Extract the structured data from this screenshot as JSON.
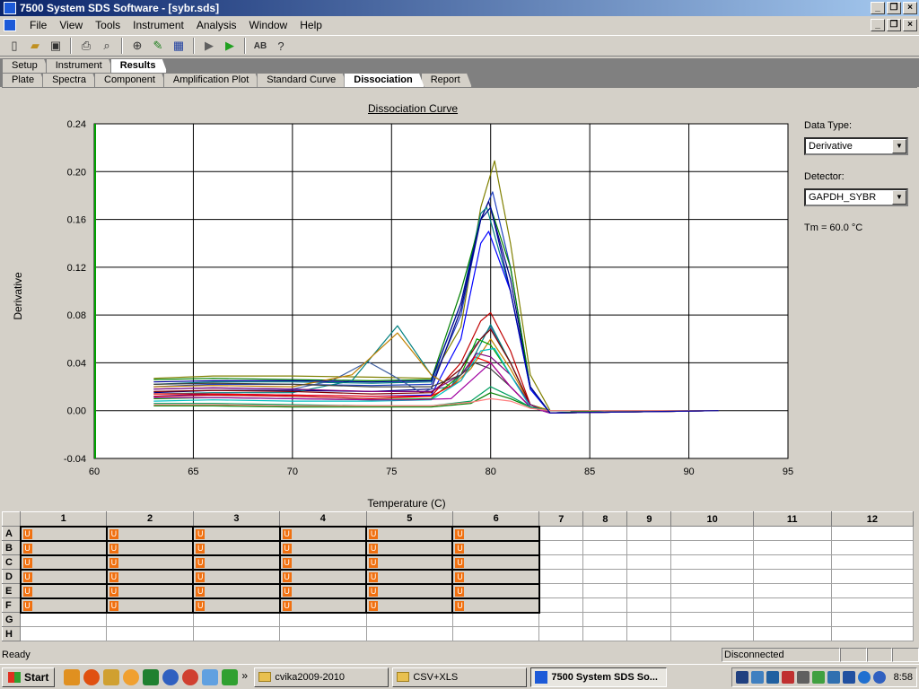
{
  "window": {
    "title": "7500 System SDS Software - [sybr.sds]"
  },
  "menu": [
    "File",
    "View",
    "Tools",
    "Instrument",
    "Analysis",
    "Window",
    "Help"
  ],
  "tabs_top": [
    "Setup",
    "Instrument",
    "Results"
  ],
  "tabs_top_active": "Results",
  "tabs_sub": [
    "Plate",
    "Spectra",
    "Component",
    "Amplification Plot",
    "Standard Curve",
    "Dissociation",
    "Report"
  ],
  "tabs_sub_active": "Dissociation",
  "side": {
    "data_type_label": "Data Type:",
    "data_type_value": "Derivative",
    "detector_label": "Detector:",
    "detector_value": "GAPDH_SYBR",
    "tm_text": "Tm = 60.0 °C"
  },
  "chart_data": {
    "type": "line",
    "title": "Dissociation Curve",
    "xlabel": "Temperature (C)",
    "ylabel": "Derivative",
    "xlim": [
      60,
      95
    ],
    "ylim": [
      -0.04,
      0.24
    ],
    "xticks": [
      60,
      65,
      70,
      75,
      80,
      85,
      90,
      95
    ],
    "yticks": [
      "0.24",
      "0.20",
      "0.16",
      "0.12",
      "0.08",
      "0.04",
      "0.00",
      "-0.04"
    ],
    "grid": true,
    "series": [
      {
        "color": "#808000",
        "x": [
          63,
          66,
          70,
          74,
          77,
          78.5,
          79.5,
          80.2,
          81,
          82,
          83,
          86,
          91.5
        ],
        "y": [
          0.027,
          0.029,
          0.029,
          0.028,
          0.027,
          0.07,
          0.17,
          0.209,
          0.14,
          0.03,
          0.0,
          0.0,
          0.0
        ]
      },
      {
        "color": "#2040c0",
        "x": [
          63,
          66,
          70,
          74,
          77,
          78.5,
          79.5,
          80.1,
          81,
          82,
          83,
          86,
          91.5
        ],
        "y": [
          0.02,
          0.022,
          0.022,
          0.021,
          0.022,
          0.08,
          0.16,
          0.183,
          0.12,
          0.02,
          -0.002,
          0.0,
          0.0
        ]
      },
      {
        "color": "#000080",
        "x": [
          63,
          66,
          70,
          74,
          77,
          78.5,
          79.5,
          79.9,
          81,
          82,
          83,
          86,
          91.5
        ],
        "y": [
          0.015,
          0.017,
          0.017,
          0.016,
          0.018,
          0.085,
          0.16,
          0.175,
          0.11,
          0.02,
          -0.002,
          0.0,
          0.0
        ]
      },
      {
        "color": "#008080",
        "x": [
          63,
          66,
          70,
          74,
          77,
          78.5,
          79.5,
          79.8,
          81,
          82,
          83,
          86,
          91.5
        ],
        "y": [
          0.022,
          0.024,
          0.024,
          0.023,
          0.024,
          0.09,
          0.165,
          0.17,
          0.1,
          0.018,
          -0.002,
          0.0,
          0.0
        ]
      },
      {
        "color": "#0000ff",
        "x": [
          63,
          66,
          70,
          74,
          77,
          78.5,
          79.5,
          79.9,
          81,
          82,
          83,
          86,
          91.5
        ],
        "y": [
          0.012,
          0.014,
          0.013,
          0.012,
          0.013,
          0.06,
          0.14,
          0.15,
          0.1,
          0.018,
          -0.002,
          0.0,
          0.0
        ]
      },
      {
        "color": "#008000",
        "x": [
          63,
          66,
          70,
          74,
          77,
          78.5,
          79.5,
          80.0,
          81,
          82,
          83,
          86,
          91.5
        ],
        "y": [
          0.026,
          0.027,
          0.026,
          0.025,
          0.026,
          0.1,
          0.16,
          0.17,
          0.12,
          0.02,
          -0.002,
          0.0,
          0.0
        ]
      },
      {
        "color": "#4060a0",
        "x": [
          63,
          66,
          70,
          72,
          73.8,
          75,
          76.5,
          77,
          78,
          79,
          80,
          81,
          82,
          83,
          91.5
        ],
        "y": [
          0.018,
          0.019,
          0.018,
          0.025,
          0.041,
          0.03,
          0.015,
          0.018,
          0.02,
          0.05,
          0.07,
          0.04,
          0.005,
          0.0,
          0.0
        ]
      },
      {
        "color": "#008080",
        "x": [
          63,
          66,
          70,
          73,
          75.3,
          77,
          78,
          79,
          80,
          81,
          82,
          83,
          91.5
        ],
        "y": [
          0.014,
          0.015,
          0.015,
          0.025,
          0.071,
          0.03,
          0.02,
          0.04,
          0.072,
          0.04,
          0.005,
          0.0,
          0.0
        ]
      },
      {
        "color": "#c08000",
        "x": [
          63,
          66,
          70,
          73,
          75.3,
          77,
          78,
          79,
          80,
          81,
          82,
          83,
          91.5
        ],
        "y": [
          0.02,
          0.021,
          0.02,
          0.03,
          0.065,
          0.03,
          0.02,
          0.035,
          0.06,
          0.035,
          0.005,
          0.0,
          0.0
        ]
      },
      {
        "color": "#c00000",
        "x": [
          63,
          66,
          70,
          74,
          77,
          78.5,
          79.5,
          80,
          81,
          82,
          83,
          91.5
        ],
        "y": [
          0.012,
          0.013,
          0.012,
          0.01,
          0.012,
          0.04,
          0.075,
          0.082,
          0.05,
          0.005,
          -0.002,
          0.0
        ]
      },
      {
        "color": "#800000",
        "x": [
          63,
          66,
          70,
          74,
          77,
          78.5,
          79.5,
          80,
          81,
          82,
          83,
          91.5
        ],
        "y": [
          0.016,
          0.017,
          0.016,
          0.014,
          0.015,
          0.035,
          0.06,
          0.068,
          0.04,
          0.005,
          -0.002,
          0.0
        ]
      },
      {
        "color": "#00a000",
        "x": [
          63,
          66,
          70,
          74,
          77,
          78.5,
          79.3,
          80,
          81,
          82,
          83,
          91.5
        ],
        "y": [
          0.01,
          0.011,
          0.01,
          0.009,
          0.01,
          0.03,
          0.06,
          0.055,
          0.03,
          0.005,
          -0.002,
          0.0
        ]
      },
      {
        "color": "#800080",
        "x": [
          63,
          66,
          70,
          74,
          77,
          78.5,
          79.3,
          80,
          81,
          82,
          83,
          91.5
        ],
        "y": [
          0.018,
          0.019,
          0.018,
          0.016,
          0.016,
          0.03,
          0.048,
          0.045,
          0.03,
          0.005,
          -0.002,
          0.0
        ]
      },
      {
        "color": "#ff0000",
        "x": [
          63,
          66,
          70,
          74,
          77,
          78.5,
          79.2,
          80,
          81,
          82,
          83,
          91.5
        ],
        "y": [
          0.014,
          0.014,
          0.013,
          0.012,
          0.012,
          0.025,
          0.045,
          0.04,
          0.02,
          0.003,
          -0.002,
          0.0
        ]
      },
      {
        "color": "#404040",
        "x": [
          63,
          66,
          70,
          74,
          77,
          78.5,
          79.2,
          80,
          81,
          82,
          83,
          91.5
        ],
        "y": [
          0.022,
          0.023,
          0.022,
          0.02,
          0.02,
          0.03,
          0.04,
          0.035,
          0.02,
          0.003,
          -0.002,
          0.0
        ]
      },
      {
        "color": "#00c0c0",
        "x": [
          63,
          66,
          70,
          74,
          77,
          78.5,
          79.5,
          80.2,
          81,
          82,
          83,
          91.5
        ],
        "y": [
          0.008,
          0.009,
          0.008,
          0.008,
          0.009,
          0.025,
          0.05,
          0.052,
          0.03,
          0.003,
          -0.002,
          0.0
        ]
      },
      {
        "color": "#a000a0",
        "x": [
          63,
          66,
          70,
          74,
          76,
          78,
          79,
          80,
          81,
          82,
          83,
          91.5
        ],
        "y": [
          0.011,
          0.011,
          0.01,
          0.009,
          0.009,
          0.01,
          0.025,
          0.04,
          0.02,
          0.003,
          -0.002,
          0.0
        ]
      },
      {
        "color": "#008000",
        "x": [
          63,
          66,
          70,
          74,
          77,
          79,
          80,
          81,
          82,
          83,
          91.5
        ],
        "y": [
          0.004,
          0.004,
          0.003,
          0.003,
          0.003,
          0.006,
          0.015,
          0.01,
          0.003,
          0.0,
          0.0
        ]
      },
      {
        "color": "#00a060",
        "x": [
          63,
          66,
          70,
          74,
          77,
          79,
          80,
          81,
          82,
          83,
          91.5
        ],
        "y": [
          0.006,
          0.006,
          0.005,
          0.004,
          0.004,
          0.008,
          0.02,
          0.012,
          0.003,
          0.0,
          0.0
        ]
      },
      {
        "color": "#ff8080",
        "x": [
          63,
          66,
          70,
          74,
          77,
          79,
          80,
          81,
          82,
          83,
          91.5
        ],
        "y": [
          0.005,
          0.005,
          0.004,
          0.004,
          0.004,
          0.007,
          0.01,
          0.008,
          0.002,
          0.0,
          0.0
        ]
      },
      {
        "color": "#0000a0",
        "x": [
          63,
          66,
          70,
          74,
          77,
          78.5,
          79.5,
          80,
          81,
          82,
          83,
          91.5
        ],
        "y": [
          0.024,
          0.025,
          0.025,
          0.024,
          0.025,
          0.09,
          0.16,
          0.17,
          0.1,
          0.02,
          -0.002,
          0.0
        ]
      }
    ]
  },
  "plate": {
    "columns": [
      "1",
      "2",
      "3",
      "4",
      "5",
      "6",
      "7",
      "8",
      "9",
      "10",
      "11",
      "12"
    ],
    "rows": [
      "A",
      "B",
      "C",
      "D",
      "E",
      "F",
      "G",
      "H"
    ],
    "well_label": "U",
    "filled_rows": 6,
    "filled_cols": 6
  },
  "status": {
    "left": "Ready",
    "right": "Disconnected"
  },
  "taskbar": {
    "start": "Start",
    "tasks": [
      "cvika2009-2010",
      "CSV+XLS",
      "7500 System SDS So..."
    ],
    "clock": "8:58"
  }
}
